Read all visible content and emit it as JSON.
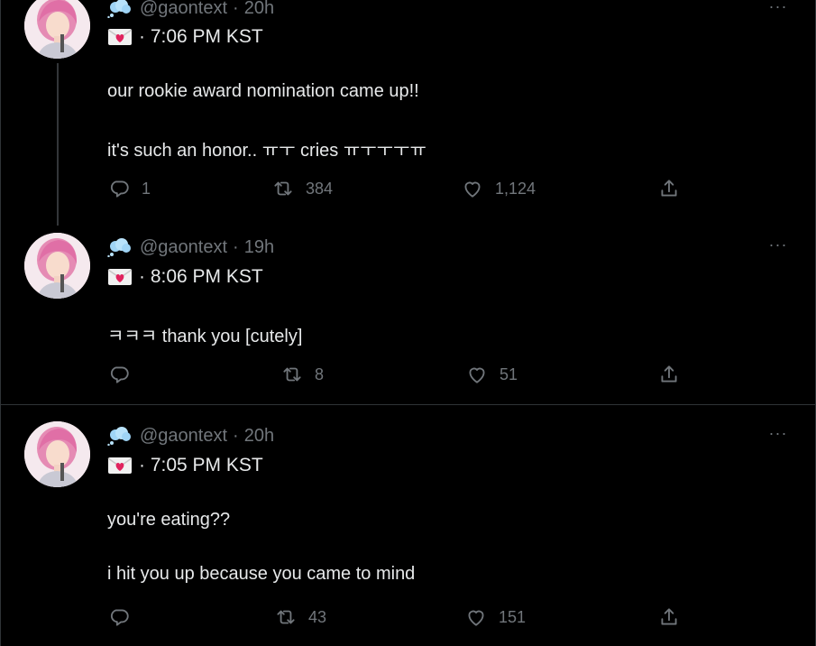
{
  "tweets": [
    {
      "handle": "@gaontext",
      "separator": "·",
      "age": "20h",
      "time": "· 7:06 PM KST",
      "lines": [
        "our rookie award nomination came up!!",
        "it's such an honor.. ㅠㅜ cries ㅠㅜㅜㅜㅠ"
      ],
      "replies": "1",
      "retweets": "384",
      "likes": "1,124",
      "more": "···"
    },
    {
      "handle": "@gaontext",
      "separator": "·",
      "age": "19h",
      "time": "· 8:06 PM KST",
      "lines": [
        "ㅋㅋㅋ thank you [cutely]"
      ],
      "replies": "",
      "retweets": "8",
      "likes": "51",
      "more": "···"
    },
    {
      "handle": "@gaontext",
      "separator": "·",
      "age": "20h",
      "time": "· 7:05 PM KST",
      "lines": [
        "you're eating??",
        "i hit you up because you came to mind"
      ],
      "replies": "",
      "retweets": "43",
      "likes": "151",
      "more": "···"
    }
  ],
  "icons": {
    "reply": "reply-icon",
    "retweet": "retweet-icon",
    "like": "heart-icon",
    "share": "share-icon",
    "cloud": "thought-cloud-icon",
    "mail": "love-letter-icon"
  },
  "colors": {
    "background": "#000000",
    "text": "#e7e9ea",
    "muted": "#71767b",
    "border": "#2f3336"
  }
}
